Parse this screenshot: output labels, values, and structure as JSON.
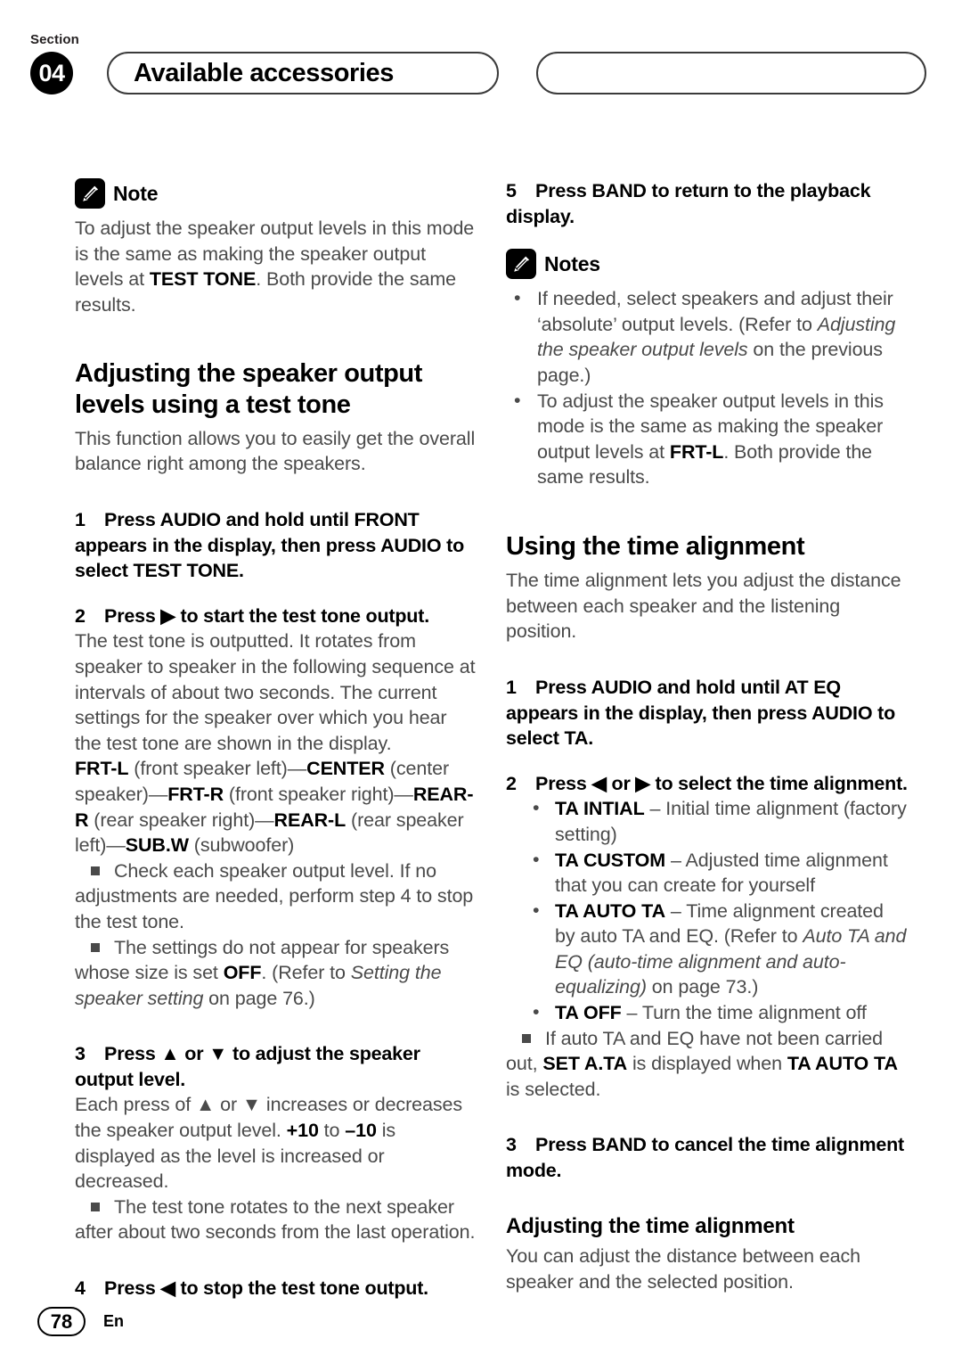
{
  "header": {
    "section_word": "Section",
    "section_number": "04",
    "chapter_title": "Available accessories"
  },
  "icons": {
    "note_icon": "pencil-icon",
    "bullet_square": "square-bullet",
    "bullet_round": "round-bullet"
  },
  "left_column": {
    "note_label": "Note",
    "note_body_html": "To adjust the speaker output levels in this mode is the same as making the speaker output levels at <b>TEST TONE</b>. Both provide the same results.",
    "heading": "Adjusting the speaker output levels using a test tone",
    "intro": "This function allows you to easily get the overall balance right among the speakers.",
    "step1": "1 Press AUDIO and hold until FRONT appears in the display, then press AUDIO to select TEST TONE.",
    "step2": "2 Press ▶ to start the test tone output.",
    "step2_body": "The test tone is outputted. It rotates from speaker to speaker in the following sequence at intervals of about two seconds. The current settings for the speaker over which you hear the test tone are shown in the display.",
    "sequence_html": "<b>FRT-L</b> (front speaker left)—<b>CENTER</b> (center speaker)—<b>FRT-R</b> (front speaker right)—<b>REAR-R</b> (rear speaker right)—<b>REAR-L</b> (rear speaker left)—<b>SUB.W</b> (subwoofer)",
    "note_a_html": "Check each speaker output level. If no adjustments are needed, perform step 4 to stop the test tone.",
    "note_b_html": "The settings do not appear for speakers whose size is set <b>OFF</b>. (Refer to <i>Setting the speaker setting</i> on page 76.)",
    "step3": "3 Press ▲ or ▼ to adjust the speaker output level.",
    "step3_body_html": "Each press of ▲ or ▼ increases or decreases the speaker output level. <b>+10</b> to <b>–10</b> is displayed as the level is increased or decreased.",
    "note_c_html": "The test tone rotates to the next speaker after about two seconds from the last operation.",
    "step4": "4 Press ◀ to stop the test tone output."
  },
  "right_column": {
    "step5": "5 Press BAND to return to the playback display.",
    "notes_label": "Notes",
    "notes": [
      "If needed, select speakers and adjust their ‘absolute’ output levels. (Refer to <i>Adjusting the speaker output levels</i> on the previous page.)",
      "To adjust the speaker output levels in this mode is the same as making the speaker output levels at <b>FRT-L</b>. Both provide the same results."
    ],
    "heading": "Using the time alignment",
    "intro": "The time alignment lets you adjust the distance between each speaker and the listening position.",
    "step1": "1 Press AUDIO and hold until AT EQ appears in the display, then press AUDIO to select TA.",
    "step2": "2 Press ◀ or ▶ to select the time alignment.",
    "options": [
      "<b>TA INTIAL</b> – Initial time alignment (factory setting)",
      "<b>TA CUSTOM</b> – Adjusted time alignment that you can create for yourself",
      "<b>TA AUTO TA</b> – Time alignment created by auto TA and EQ. (Refer to <i>Auto TA and EQ (auto-time alignment and auto-equalizing)</i> on page 73.)",
      "<b>TA OFF</b> – Turn the time alignment off"
    ],
    "note_html": "If auto TA and EQ have not been carried out, <b>SET A.TA</b> is displayed when <b>TA AUTO TA</b> is selected.",
    "step3": "3 Press BAND to cancel the time alignment mode.",
    "subheading": "Adjusting the time alignment",
    "sub_body": "You can adjust the distance between each speaker and the selected position."
  },
  "footer": {
    "page_number": "78",
    "language": "En"
  }
}
